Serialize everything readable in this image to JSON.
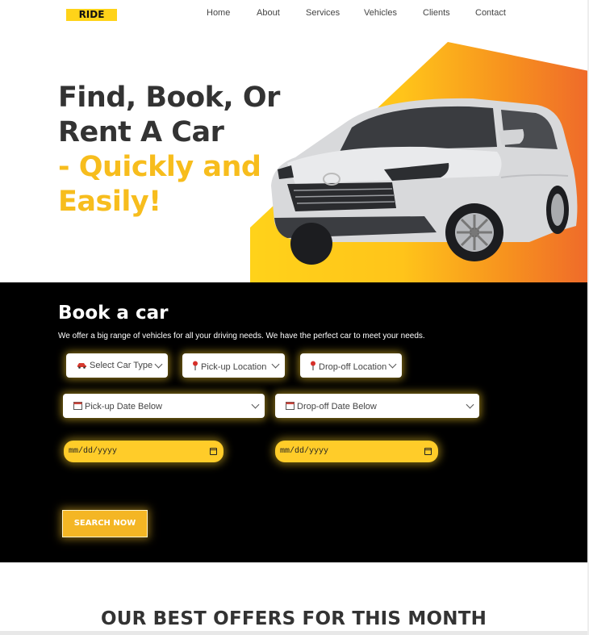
{
  "brand": {
    "logo": "RIDE"
  },
  "nav": {
    "items": [
      "Home",
      "About",
      "Services",
      "Vehicles",
      "Clients",
      "Contact"
    ]
  },
  "hero": {
    "title_line1": "Find, Book, Or",
    "title_line2": "Rent A Car",
    "accent_line1": "- Quickly and",
    "accent_line2": "Easily!"
  },
  "booking": {
    "title": "Book a car",
    "description": "We offer a big range of vehicles for all your driving needs. We have the perfect car to meet your needs.",
    "selects": {
      "car_type": "Select Car Type",
      "pickup_location": "Pick-up Location",
      "dropoff_location": "Drop-off Location",
      "pickup_date": "Pick-up Date Below",
      "dropoff_date": "Drop-off Date Below"
    },
    "date_inputs": {
      "pickup_placeholder": "mm/dd/yyyy",
      "dropoff_placeholder": "mm/dd/yyyy"
    },
    "search_button": "SEARCH NOW"
  },
  "offers": {
    "title": "OUR BEST OFFERS FOR THIS MONTH"
  },
  "colors": {
    "accent": "#f7bd1d",
    "dark": "#000000",
    "brand_yellow": "#ffd319",
    "text": "#333333"
  },
  "icons": [
    "car-icon",
    "location-pin-icon",
    "calendar-icon",
    "chevron-down-icon"
  ]
}
